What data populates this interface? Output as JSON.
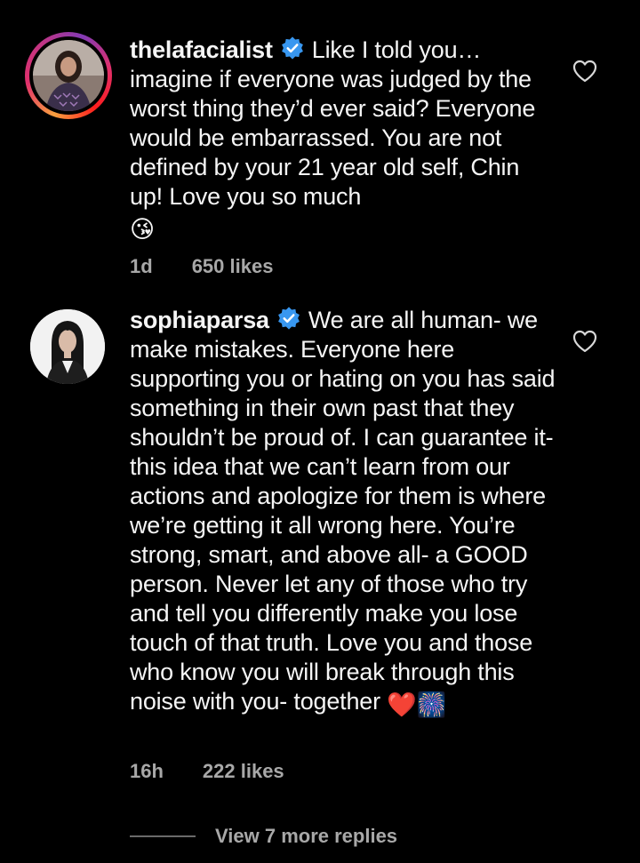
{
  "comments": [
    {
      "username": "thelafacialist",
      "verified": true,
      "text": "Like I told you… imagine if everyone was judged by the worst thing they’d ever said? Everyone would be embarrassed. You are not defined by your 21 year old self, Chin up! Love you so much",
      "emoji": "😘",
      "time": "1d",
      "likes": "650 likes"
    },
    {
      "username": "sophiaparsa",
      "verified": true,
      "text": "We are all human- we make mistakes. Everyone here supporting you or hating on you has said something in their own past that they shouldn’t be proud of. I can guarantee it- this idea that we can’t learn from our actions and apologize for them is where we’re getting it all wrong here. You’re strong, smart, and above all- a GOOD person. Never let any of those who try and tell you differently make you lose touch of that truth. Love you and those who know you will break through this noise with you- together",
      "emoji": "❤️",
      "emoji2": "🎆",
      "time": "16h",
      "likes": "222 likes"
    }
  ],
  "view_replies": "View 7 more replies",
  "colors": {
    "background": "#000000",
    "text": "#f5f5f5",
    "meta": "#a8a8a8",
    "verified": "#3897f0"
  },
  "icons": [
    "verified-badge-icon",
    "heart-outline-icon"
  ]
}
